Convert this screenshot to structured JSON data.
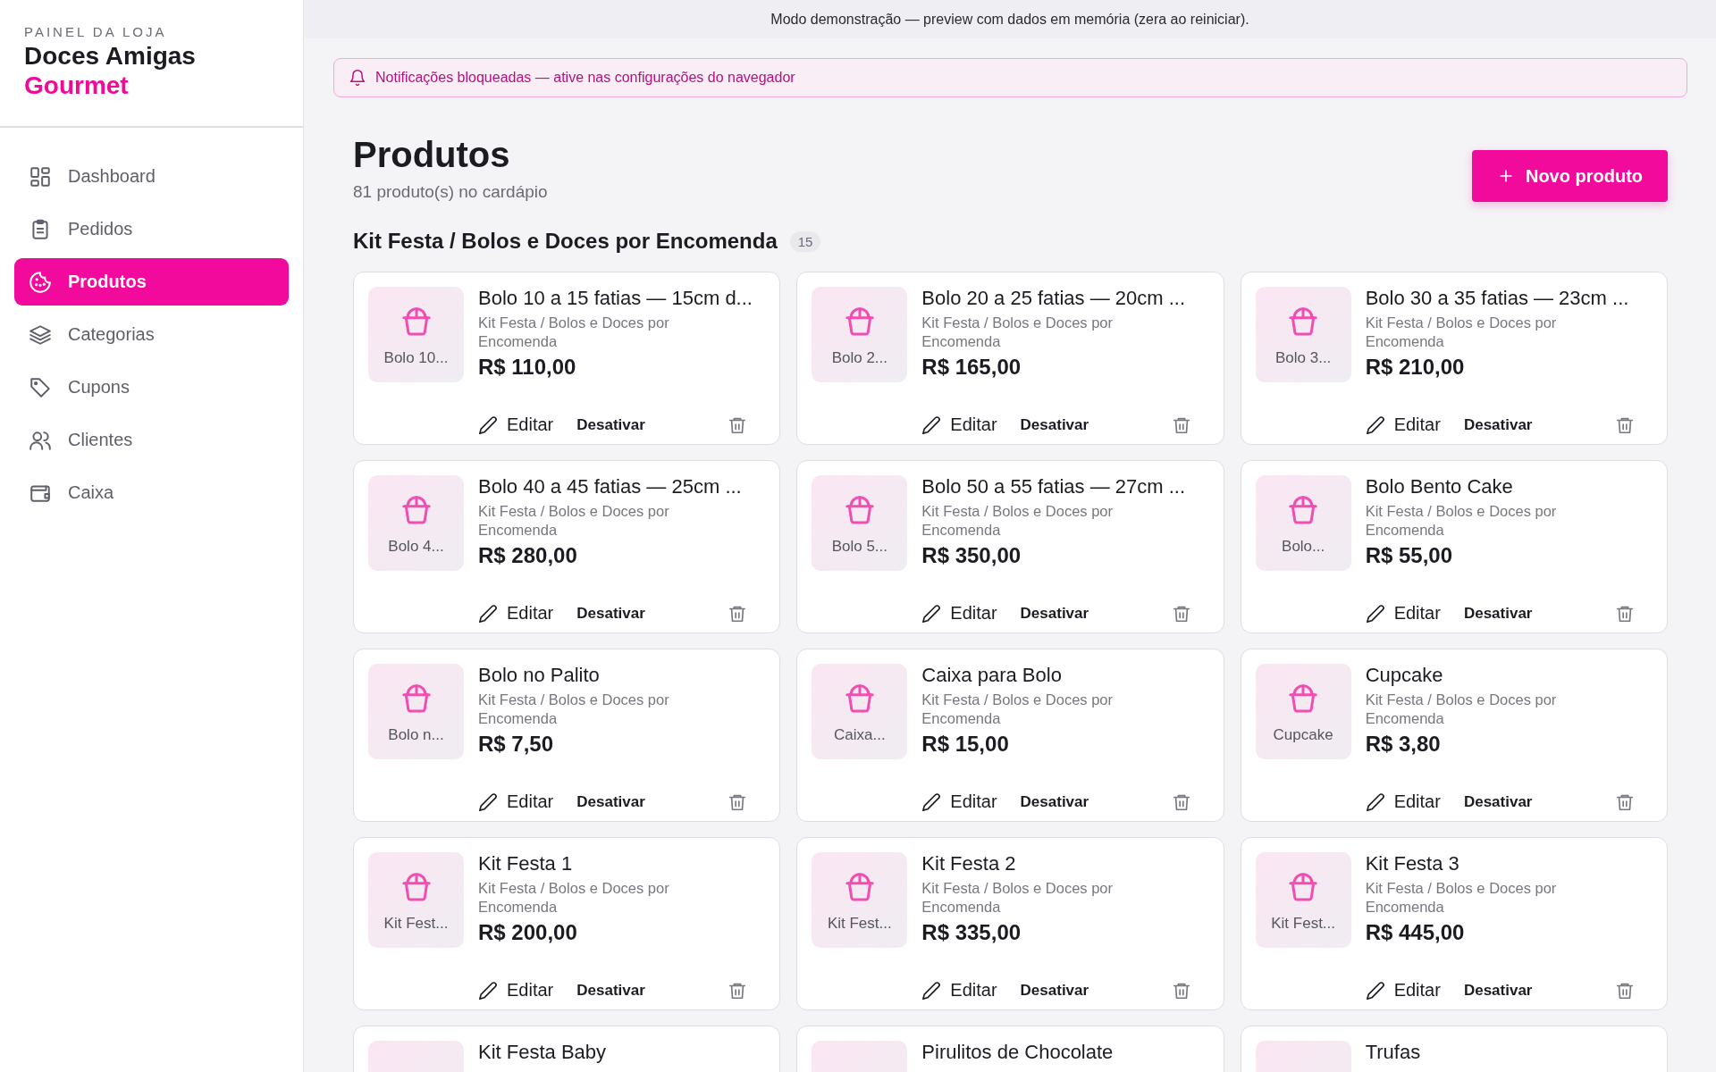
{
  "demo_bar": "Modo demonstração — preview com dados em memória (zera ao reiniciar).",
  "sidebar": {
    "eyebrow": "PAINEL DA LOJA",
    "brand": "Doces Amigas",
    "brand_accent": "Gourmet",
    "items": [
      {
        "label": "Dashboard",
        "selected": false
      },
      {
        "label": "Pedidos",
        "selected": false
      },
      {
        "label": "Produtos",
        "selected": true
      },
      {
        "label": "Categorias",
        "selected": false
      },
      {
        "label": "Cupons",
        "selected": false
      },
      {
        "label": "Clientes",
        "selected": false
      },
      {
        "label": "Caixa",
        "selected": false
      }
    ]
  },
  "notice": "Notificações bloqueadas — ative nas configurações do navegador",
  "page": {
    "title": "Produtos",
    "subtitle": "81 produto(s) no cardápio",
    "new_button": "Novo produto"
  },
  "section": {
    "title": "Kit Festa / Bolos e Doces por Encomenda",
    "count": "15",
    "products": [
      {
        "thumb": "Bolo 10...",
        "name": "Bolo 10 a 15 fatias — 15cm d...",
        "category": "Kit Festa / Bolos e Doces por Encomenda",
        "price": "R$ 110,00",
        "edit": "Editar",
        "toggle": "Desativar"
      },
      {
        "thumb": "Bolo 2...",
        "name": "Bolo 20 a 25 fatias — 20cm ...",
        "category": "Kit Festa / Bolos e Doces por Encomenda",
        "price": "R$ 165,00",
        "edit": "Editar",
        "toggle": "Desativar"
      },
      {
        "thumb": "Bolo 3...",
        "name": "Bolo 30 a 35 fatias — 23cm ...",
        "category": "Kit Festa / Bolos e Doces por Encomenda",
        "price": "R$ 210,00",
        "edit": "Editar",
        "toggle": "Desativar"
      },
      {
        "thumb": "Bolo 4...",
        "name": "Bolo 40 a 45 fatias — 25cm ...",
        "category": "Kit Festa / Bolos e Doces por Encomenda",
        "price": "R$ 280,00",
        "edit": "Editar",
        "toggle": "Desativar"
      },
      {
        "thumb": "Bolo 5...",
        "name": "Bolo 50 a 55 fatias — 27cm ...",
        "category": "Kit Festa / Bolos e Doces por Encomenda",
        "price": "R$ 350,00",
        "edit": "Editar",
        "toggle": "Desativar"
      },
      {
        "thumb": "Bolo...",
        "name": "Bolo Bento Cake",
        "category": "Kit Festa / Bolos e Doces por Encomenda",
        "price": "R$ 55,00",
        "edit": "Editar",
        "toggle": "Desativar"
      },
      {
        "thumb": "Bolo n...",
        "name": "Bolo no Palito",
        "category": "Kit Festa / Bolos e Doces por Encomenda",
        "price": "R$ 7,50",
        "edit": "Editar",
        "toggle": "Desativar"
      },
      {
        "thumb": "Caixa...",
        "name": "Caixa para Bolo",
        "category": "Kit Festa / Bolos e Doces por Encomenda",
        "price": "R$ 15,00",
        "edit": "Editar",
        "toggle": "Desativar"
      },
      {
        "thumb": "Cupcake",
        "name": "Cupcake",
        "category": "Kit Festa / Bolos e Doces por Encomenda",
        "price": "R$ 3,80",
        "edit": "Editar",
        "toggle": "Desativar"
      },
      {
        "thumb": "Kit Fest...",
        "name": "Kit Festa 1",
        "category": "Kit Festa / Bolos e Doces por Encomenda",
        "price": "R$ 200,00",
        "edit": "Editar",
        "toggle": "Desativar"
      },
      {
        "thumb": "Kit Fest...",
        "name": "Kit Festa 2",
        "category": "Kit Festa / Bolos e Doces por Encomenda",
        "price": "R$ 335,00",
        "edit": "Editar",
        "toggle": "Desativar"
      },
      {
        "thumb": "Kit Fest...",
        "name": "Kit Festa 3",
        "category": "Kit Festa / Bolos e Doces por Encomenda",
        "price": "R$ 445,00",
        "edit": "Editar",
        "toggle": "Desativar"
      },
      {
        "name": "Kit Festa Baby"
      },
      {
        "name": "Pirulitos de Chocolate"
      },
      {
        "name": "Trufas"
      }
    ]
  }
}
